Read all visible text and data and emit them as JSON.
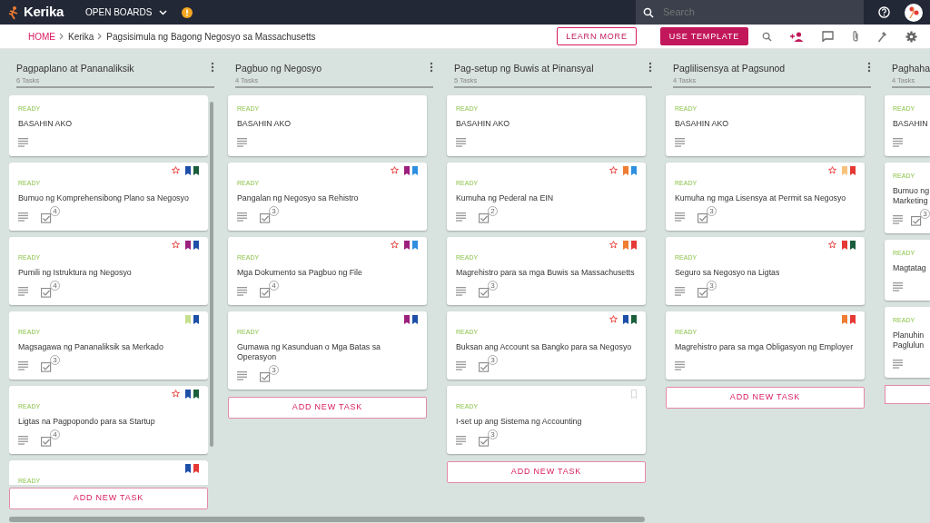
{
  "navbar": {
    "logo": "Kerika",
    "menu": "OPEN BOARDS",
    "search": {
      "placeholder": "Search"
    }
  },
  "breadcrumb": [
    {
      "label": "HOME",
      "link": true
    },
    {
      "label": "Kerika",
      "link": false
    },
    {
      "label": "Pagsisimula ng Bagong Negosyo sa Massachusetts",
      "link": false
    }
  ],
  "actions": [
    {
      "label": "LEARN MORE",
      "kind": "outline"
    },
    {
      "label": "USE TEMPLATE",
      "kind": "filled"
    }
  ],
  "columns": [
    {
      "title": "Pagpaplano at Pananaliksik",
      "count": "6 Tasks",
      "scroll": true,
      "add_button": "ADD NEW TASK",
      "cards": [
        {
          "status": "READY",
          "title": "BASAHIN AKO",
          "starred": false
        },
        {
          "status": "READY",
          "title": "Bumuo ng Komprehensibong Plano sa Negosyo",
          "starred": true,
          "tags": [
            {
              "color": "#1e4fa8"
            },
            {
              "color": "#1b5e3b"
            }
          ],
          "checklist": "4"
        },
        {
          "status": "READY",
          "title": "Pumili ng Istruktura ng Negosyo",
          "starred": true,
          "tags": [
            {
              "color": "#9c1f7e"
            },
            {
              "color": "#1e4fa8"
            }
          ],
          "checklist": "4"
        },
        {
          "status": "READY",
          "title": "Magsagawa ng Pananaliksik sa Merkado",
          "starred": false,
          "tags": [
            {
              "color": "#c5e08f"
            },
            {
              "color": "#1e4fa8"
            }
          ],
          "checklist": "3"
        },
        {
          "status": "READY",
          "title": "Ligtas na Pagpopondo para sa Startup",
          "starred": true,
          "tags": [
            {
              "color": "#1e4fa8"
            },
            {
              "color": "#1b5e3b"
            }
          ],
          "checklist": "4"
        },
        {
          "status": "READY",
          "starred": false,
          "tags": [
            {
              "color": "#1e4fa8"
            },
            {
              "color": "#e53935"
            }
          ]
        }
      ]
    },
    {
      "title": "Pagbuo ng Negosyo",
      "count": "4 Tasks",
      "add_button": "ADD NEW TASK",
      "cards": [
        {
          "status": "READY",
          "title": "BASAHIN AKO",
          "starred": false
        },
        {
          "status": "READY",
          "title": "Pangalan ng Negosyo sa Rehistro",
          "starred": true,
          "tags": [
            {
              "color": "#9c1f7e"
            },
            {
              "color": "#2e8ee0"
            }
          ],
          "checklist": "3"
        },
        {
          "status": "READY",
          "title": "Mga Dokumento sa Pagbuo ng File",
          "starred": true,
          "tags": [
            {
              "color": "#9c1f7e"
            },
            {
              "color": "#2e8ee0"
            }
          ],
          "checklist": "4"
        },
        {
          "status": "READY",
          "title": "Gumawa ng Kasunduan o Mga Batas sa Operasyon",
          "starred": false,
          "tags": [
            {
              "color": "#9c1f7e"
            },
            {
              "color": "#1e4fa8"
            }
          ],
          "checklist": "3"
        }
      ]
    },
    {
      "title": "Pag-setup ng Buwis at Pinansyal",
      "count": "5 Tasks",
      "add_button": "ADD NEW TASK",
      "cards": [
        {
          "status": "READY",
          "title": "BASAHIN AKO",
          "starred": false
        },
        {
          "status": "READY",
          "title": "Kumuha ng Pederal na EIN",
          "starred": true,
          "tags": [
            {
              "color": "#ef7d32"
            },
            {
              "color": "#2e8ee0"
            }
          ],
          "checklist": "2"
        },
        {
          "status": "READY",
          "title": "Magrehistro para sa mga Buwis sa Massachusetts",
          "starred": true,
          "tags": [
            {
              "color": "#ef7d32"
            },
            {
              "color": "#e53935"
            }
          ],
          "checklist": "3"
        },
        {
          "status": "READY",
          "title": "Buksan ang Account sa Bangko para sa Negosyo",
          "starred": true,
          "tags": [
            {
              "color": "#1e4fa8"
            },
            {
              "color": "#1b5e3b"
            }
          ],
          "checklist": "3"
        },
        {
          "status": "READY",
          "title": "I-set up ang Sistema ng Accounting",
          "starred": false,
          "empty_bookmark": true,
          "checklist": "3"
        }
      ]
    },
    {
      "title": "Paglilisensya at Pagsunod",
      "count": "4 Tasks",
      "add_button": "ADD NEW TASK",
      "cards": [
        {
          "status": "READY",
          "title": "BASAHIN AKO",
          "starred": false
        },
        {
          "status": "READY",
          "title": "Kumuha ng mga Lisensya at Permit sa Negosyo",
          "starred": true,
          "tags": [
            {
              "color": "#f7c27e"
            },
            {
              "color": "#e53935"
            }
          ],
          "checklist": "3"
        },
        {
          "status": "READY",
          "title": "Seguro sa Negosyo na Ligtas",
          "starred": true,
          "tags": [
            {
              "color": "#e53935"
            },
            {
              "color": "#1b5e3b"
            }
          ],
          "checklist": "3"
        },
        {
          "status": "READY",
          "title": "Magrehistro para sa mga Obligasyon ng Employer",
          "starred": false,
          "tags": [
            {
              "color": "#ef7d32"
            },
            {
              "color": "#e53935"
            }
          ]
        }
      ]
    },
    {
      "title": "Paghaha",
      "count": "4 Tasks",
      "cut": true,
      "add_box": true,
      "cards": [
        {
          "status": "READY",
          "title": "BASAHIN"
        },
        {
          "status": "READY",
          "title": "Bumuo ng\nMarketing",
          "checklist": "3"
        },
        {
          "status": "READY",
          "title": "Magtatag"
        },
        {
          "status": "READY",
          "title": "Planuhin\nPaglulun"
        }
      ]
    }
  ]
}
